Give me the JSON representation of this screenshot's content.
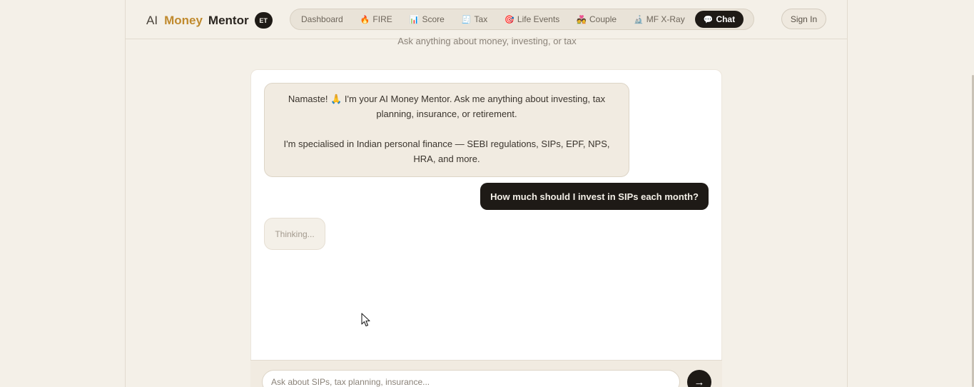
{
  "logo": {
    "ai": "AI",
    "money": "Money",
    "mentor": "Mentor",
    "badge": "ET"
  },
  "nav": {
    "items": [
      {
        "label": "Dashboard",
        "icon": ""
      },
      {
        "label": "FIRE",
        "icon": "🔥"
      },
      {
        "label": "Score",
        "icon": "📊"
      },
      {
        "label": "Tax",
        "icon": "🧾"
      },
      {
        "label": "Life Events",
        "icon": "🎯"
      },
      {
        "label": "Couple",
        "icon": "💑"
      },
      {
        "label": "MF X-Ray",
        "icon": "🔬"
      },
      {
        "label": "Chat",
        "icon": "💬"
      }
    ],
    "active": "Chat"
  },
  "signin_label": "Sign In",
  "subtitle": "Ask anything about money, investing, or tax",
  "messages": {
    "bot_p1": "Namaste! 🙏 I'm your AI Money Mentor. Ask me anything about investing, tax planning, insurance, or retirement.",
    "bot_p2": "I'm specialised in Indian personal finance — SEBI regulations, SIPs, EPF, NPS, HRA, and more.",
    "user": "How much should I invest in SIPs each month?",
    "thinking": "Thinking..."
  },
  "input": {
    "placeholder": "Ask about SIPs, tax planning, insurance...",
    "value": ""
  },
  "send_icon": "→"
}
